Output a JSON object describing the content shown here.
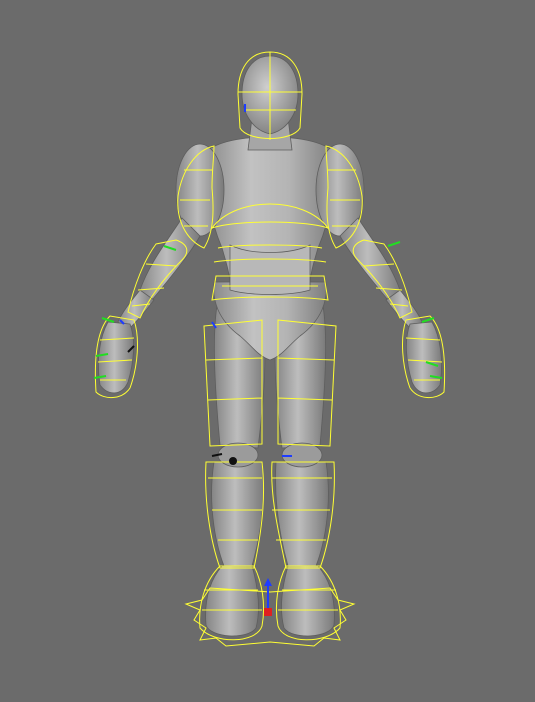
{
  "viewport": {
    "background": "#6b6b6b",
    "mesh_colors": {
      "body_fill": "#a9a9a9",
      "body_light": "#c4c4c4",
      "body_shadow": "#7d7d7d",
      "outline": "#5a5a5a"
    },
    "rig_colors": {
      "cage_wire": "#ffff33",
      "controls_green": "#22dd22",
      "axis_blue": "#1e3cff",
      "axis_red": "#e02020",
      "axis_black": "#111111"
    },
    "icons": {
      "manipulator": "move-manipulator-icon",
      "joint": "joint-pivot-icon"
    }
  }
}
